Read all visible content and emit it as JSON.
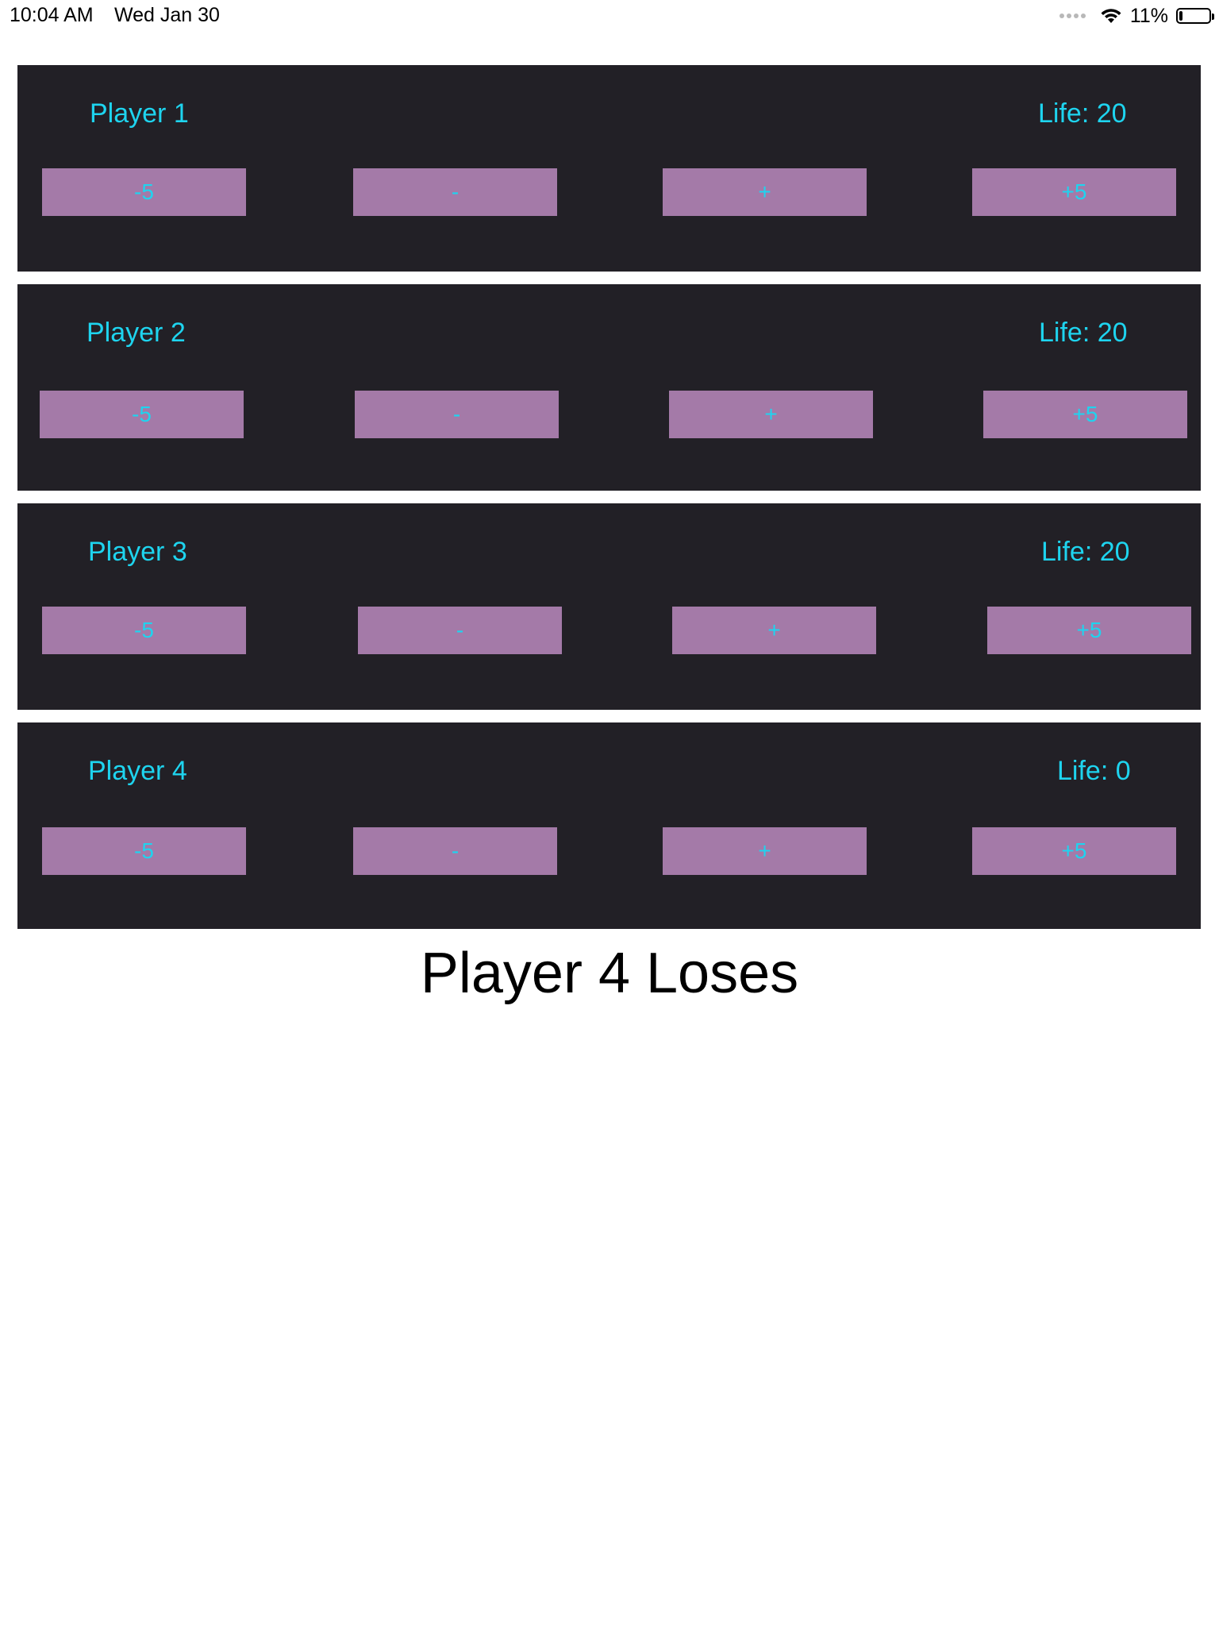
{
  "status_bar": {
    "time": "10:04 AM",
    "date": "Wed Jan 30",
    "battery_percent_label": "11%",
    "battery_level": 0.11,
    "icons": [
      "cellular-signal-icon",
      "wifi-icon",
      "battery-icon"
    ]
  },
  "colors": {
    "panel_background": "#222026",
    "button_background": "#a47aa8",
    "text_accent": "#1ed4ef",
    "result_text": "#000000"
  },
  "players": [
    {
      "name": "Player 1",
      "life": "Life: 20",
      "buttons": [
        "-5",
        "-",
        "+",
        "+5"
      ]
    },
    {
      "name": "Player 2",
      "life": "Life: 20",
      "buttons": [
        "-5",
        "-",
        "+",
        "+5"
      ]
    },
    {
      "name": "Player 3",
      "life": "Life: 20",
      "buttons": [
        "-5",
        "-",
        "+",
        "+5"
      ]
    },
    {
      "name": "Player 4",
      "life": "Life: 0",
      "buttons": [
        "-5",
        "-",
        "+",
        "+5"
      ]
    }
  ],
  "result": "Player 4 Loses"
}
